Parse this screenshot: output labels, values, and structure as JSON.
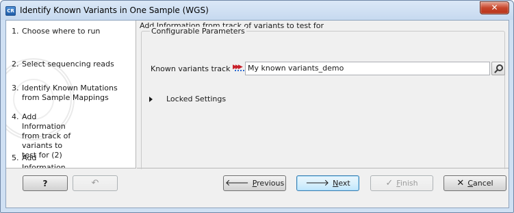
{
  "window": {
    "app_icon_text": "CR",
    "title": "Identify Known Variants in One Sample (WGS)",
    "close_glyph": "✕"
  },
  "sidebar": {
    "steps": [
      {
        "num": "1.",
        "label": "Choose where to run"
      },
      {
        "num": "2.",
        "label": "Select sequencing reads"
      },
      {
        "num": "3.",
        "label": "Identify Known Mutations from Sample Mappings"
      },
      {
        "num": "4.",
        "label": "Add Information from track of variants to test for (2)"
      },
      {
        "num": "5.",
        "label": "Add Information from track of variants to test for"
      }
    ]
  },
  "content": {
    "header": "Add Information from track of variants to test for",
    "group_title": "Configurable Parameters",
    "known_variants_label": "Known variants track",
    "known_variants_value": "My known variants_demo",
    "track_icon": "variant-track-icon",
    "browse_icon": "browse-magnifier-icon",
    "locked_settings_label": "Locked Settings"
  },
  "footer": {
    "help_label": "?",
    "reset_icon": "reset-icon",
    "previous_label": "Previous",
    "previous_mnemonic": "P",
    "previous_rest": "revious",
    "next_label": "Next",
    "next_mnemonic": "N",
    "next_rest": "ext",
    "finish_label": "Finish",
    "finish_mnemonic": "F",
    "finish_rest": "inish",
    "cancel_label": "Cancel",
    "cancel_mnemonic": "C",
    "cancel_rest": "ancel"
  },
  "colors": {
    "title_bar": "#c6d9ef",
    "close_button": "#c7462c",
    "panel_background": "#f0f0f0",
    "track_icon_red": "#c8202a",
    "cancel_icon": "#1a1a1a"
  }
}
